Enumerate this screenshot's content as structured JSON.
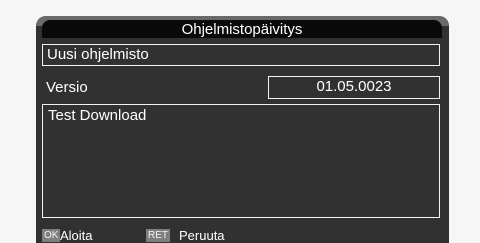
{
  "dialog": {
    "title": "Ohjelmistopäivitys",
    "software_name": "Uusi ohjelmisto",
    "version_label": "Versio",
    "version_value": "01.05.0023",
    "description": "Test Download"
  },
  "footer": {
    "ok_key": "OK",
    "ok_label": "Aloita",
    "ret_key": "RET",
    "ret_label": "Peruuta"
  }
}
